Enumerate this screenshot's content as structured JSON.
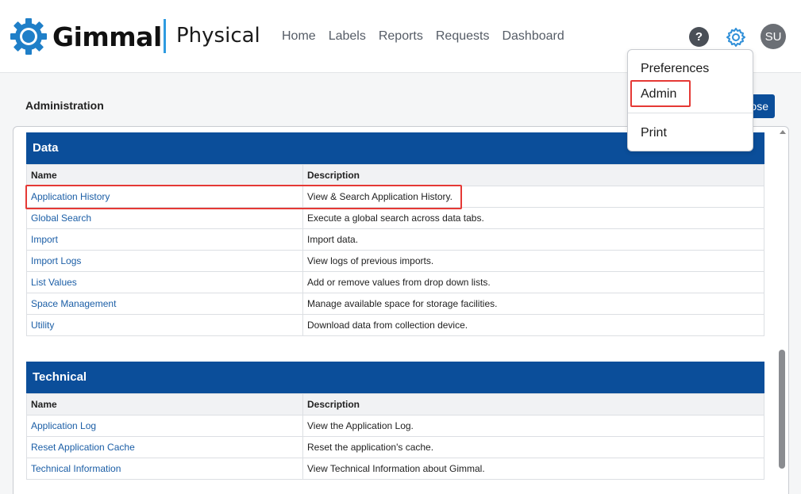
{
  "brand": {
    "name": "Gimmal",
    "product": "Physical",
    "accent": "#2f9be0"
  },
  "nav": [
    "Home",
    "Labels",
    "Reports",
    "Requests",
    "Dashboard"
  ],
  "header_icons": {
    "help": "?",
    "help_icon": "help-icon",
    "settings_icon": "gear-icon",
    "avatar": "SU"
  },
  "page": {
    "title": "Administration",
    "close_label": "ose"
  },
  "menu": {
    "items": [
      "Preferences",
      "Admin",
      "Print"
    ]
  },
  "sections": [
    {
      "title": "Data",
      "columns": [
        "Name",
        "Description"
      ],
      "rows": [
        {
          "name": "Application History",
          "description": "View & Search Application History."
        },
        {
          "name": "Global Search",
          "description": "Execute a global search across data tabs."
        },
        {
          "name": "Import",
          "description": "Import data."
        },
        {
          "name": "Import Logs",
          "description": "View logs of previous imports."
        },
        {
          "name": "List Values",
          "description": "Add or remove values from drop down lists."
        },
        {
          "name": "Space Management",
          "description": "Manage available space for storage facilities."
        },
        {
          "name": "Utility",
          "description": "Download data from collection device."
        }
      ]
    },
    {
      "title": "Technical",
      "columns": [
        "Name",
        "Description"
      ],
      "rows": [
        {
          "name": "Application Log",
          "description": "View the Application Log."
        },
        {
          "name": "Reset Application Cache",
          "description": "Reset the application's cache."
        },
        {
          "name": "Technical Information",
          "description": "View Technical Information about Gimmal."
        }
      ]
    }
  ],
  "colors": {
    "primary": "#0b4e9a",
    "link": "#1b5ea6",
    "highlight": "#e53935"
  }
}
